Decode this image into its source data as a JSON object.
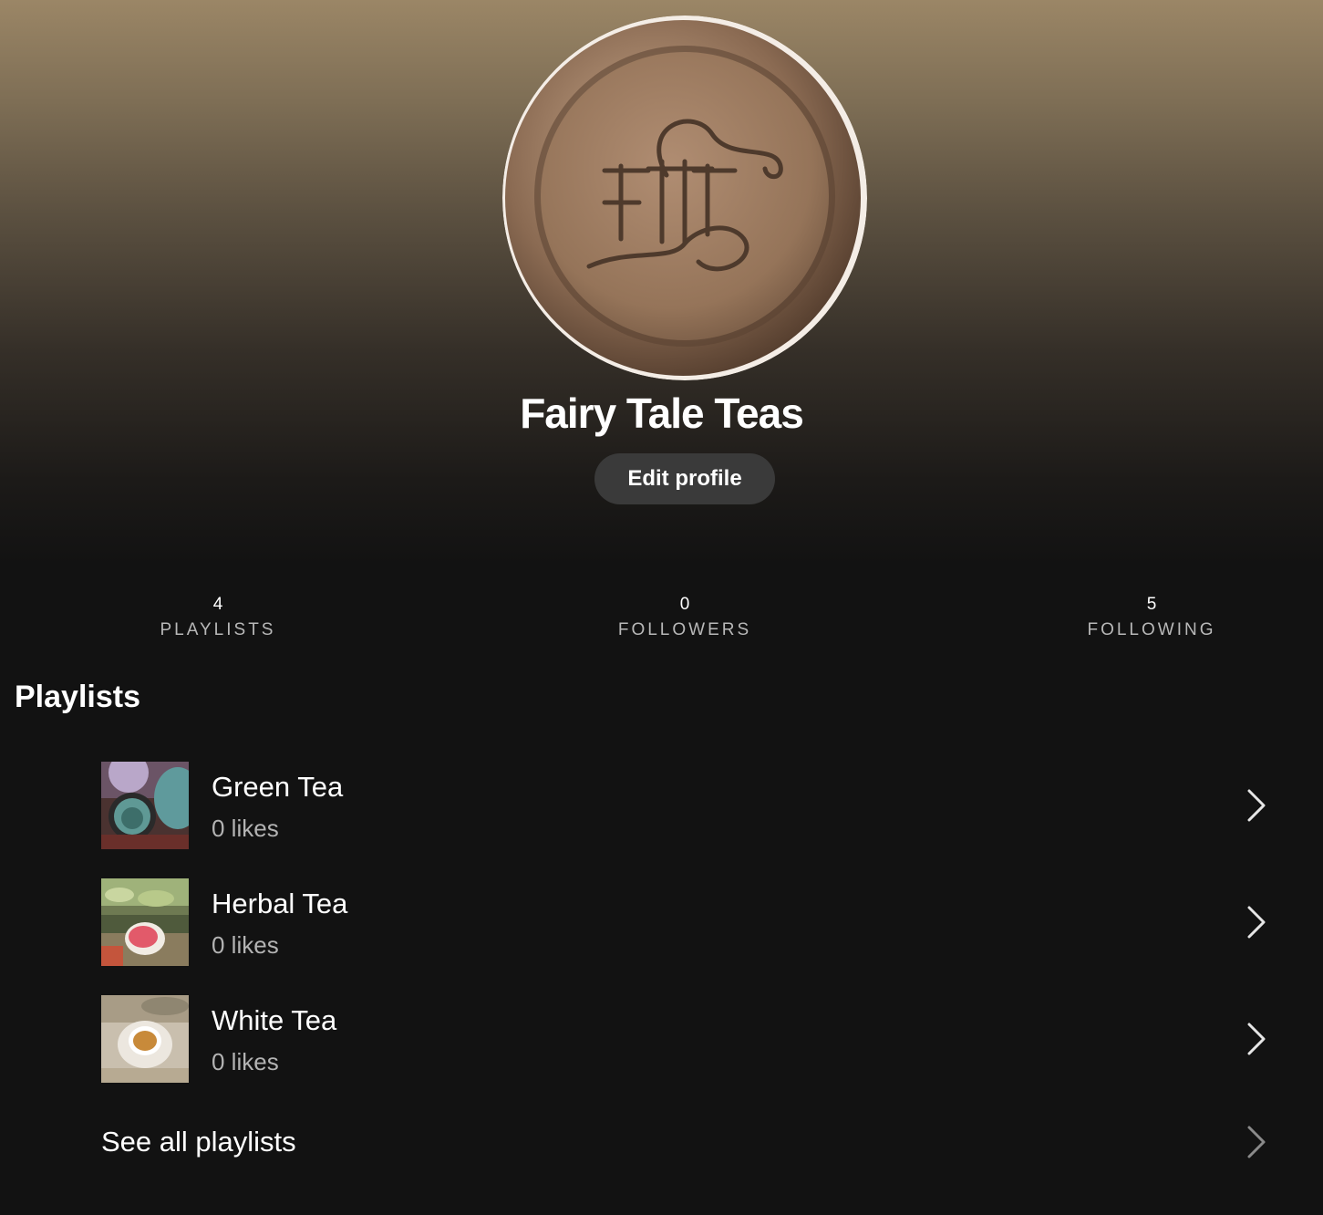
{
  "profile": {
    "name": "Fairy Tale Teas",
    "edit_label": "Edit profile",
    "avatar_monogram": "FTT"
  },
  "stats": [
    {
      "count": "4",
      "label": "PLAYLISTS"
    },
    {
      "count": "0",
      "label": "FOLLOWERS"
    },
    {
      "count": "5",
      "label": "FOLLOWING"
    }
  ],
  "playlists_section": {
    "title": "Playlists",
    "items": [
      {
        "name": "Green Tea",
        "likes": "0 likes",
        "icon": "chevron-right-icon"
      },
      {
        "name": "Herbal Tea",
        "likes": "0 likes",
        "icon": "chevron-right-icon"
      },
      {
        "name": "White Tea",
        "likes": "0 likes",
        "icon": "chevron-right-icon"
      }
    ],
    "see_all_label": "See all playlists"
  },
  "colors": {
    "background": "#121212",
    "hero_top": "#9b8666",
    "button_bg": "#3a3a3a",
    "secondary_text": "#b3b3b3",
    "wax_seal": "#9a7a60"
  }
}
